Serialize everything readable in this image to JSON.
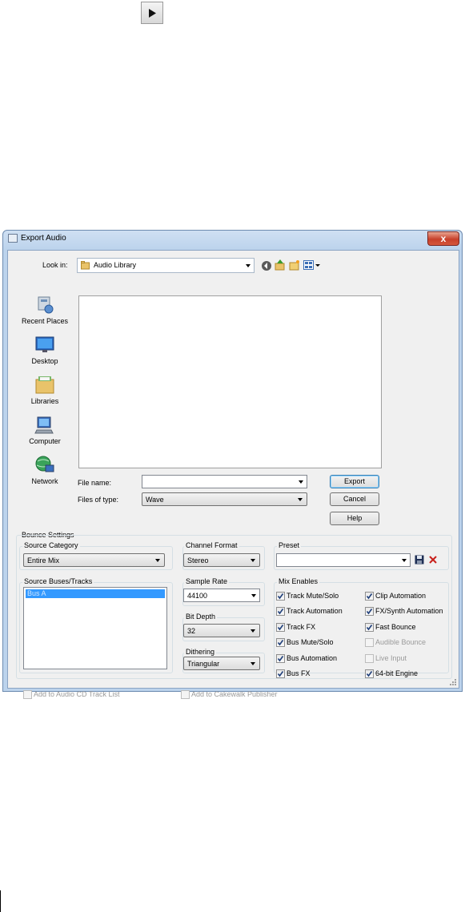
{
  "dialog": {
    "title": "Export Audio",
    "close_symbol": "x",
    "look_in_label": "Look in:",
    "look_in_value": "Audio Library",
    "places": [
      "Recent Places",
      "Desktop",
      "Libraries",
      "Computer",
      "Network"
    ],
    "file_name_label": "File name:",
    "file_name_value": "",
    "files_of_type_label": "Files of type:",
    "files_of_type_value": "Wave",
    "buttons": {
      "export": "Export",
      "cancel": "Cancel",
      "help": "Help"
    }
  },
  "bounce": {
    "section_label": "Bounce Settings",
    "source_category_label": "Source Category",
    "source_category_value": "Entire Mix",
    "source_tracks_label": "Source Buses/Tracks",
    "source_tracks_items": [
      "Bus A"
    ],
    "channel_format_label": "Channel Format",
    "channel_format_value": "Stereo",
    "sample_rate_label": "Sample Rate",
    "sample_rate_value": "44100",
    "bit_depth_label": "Bit Depth",
    "bit_depth_value": "32",
    "dithering_label": "Dithering",
    "dithering_value": "Triangular",
    "preset_label": "Preset",
    "preset_value": "",
    "mix_enables_label": "Mix Enables",
    "mix_enables": [
      {
        "label": "Track Mute/Solo",
        "checked": true,
        "enabled": true
      },
      {
        "label": "Clip Automation",
        "checked": true,
        "enabled": true
      },
      {
        "label": "Track Automation",
        "checked": true,
        "enabled": true
      },
      {
        "label": "FX/Synth Automation",
        "checked": true,
        "enabled": true
      },
      {
        "label": "Track FX",
        "checked": true,
        "enabled": true
      },
      {
        "label": "Fast Bounce",
        "checked": true,
        "enabled": true
      },
      {
        "label": "Bus Mute/Solo",
        "checked": true,
        "enabled": true
      },
      {
        "label": "Audible Bounce",
        "checked": false,
        "enabled": false
      },
      {
        "label": "Bus Automation",
        "checked": true,
        "enabled": true
      },
      {
        "label": "Live Input",
        "checked": false,
        "enabled": false
      },
      {
        "label": "Bus FX",
        "checked": true,
        "enabled": true
      },
      {
        "label": "64-bit Engine",
        "checked": true,
        "enabled": true
      }
    ],
    "add_to_cd": "Add to Audio CD Track List",
    "add_to_publisher": "Add to Cakewalk Publisher"
  },
  "colors": {
    "title_bar": "#bcd3ec",
    "selection": "#3399ff",
    "close_button": "#c7402b"
  }
}
